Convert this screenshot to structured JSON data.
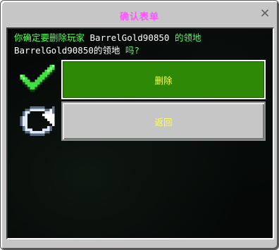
{
  "dialog": {
    "title": "确认表单",
    "close_symbol": "×",
    "message": {
      "line1_prefix": "你确定要删除玩家 ",
      "player": "BarrelGold90850",
      "line1_suffix": " 的领地",
      "line2_territory": "BarrelGold90850的领地",
      "line2_suffix": " 吗?"
    },
    "buttons": [
      {
        "label": "删除",
        "icon": "checkmark-icon"
      },
      {
        "label": "返回",
        "icon": "refresh-icon"
      }
    ]
  },
  "colors": {
    "title": "#ff55ff",
    "message_green": "#55ff55",
    "message_white": "#ffffff",
    "button_text": "#ffff55",
    "delete_button_bg": "#2e8a06",
    "back_button_bg": "#c6c6c6"
  }
}
